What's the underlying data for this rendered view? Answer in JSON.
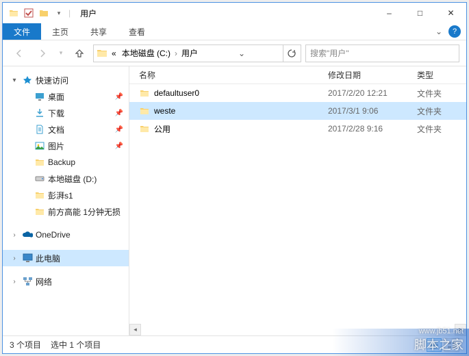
{
  "window": {
    "title": "用户",
    "minimize": "–",
    "maximize": "□",
    "close": "✕"
  },
  "ribbon": {
    "file": "文件",
    "tabs": [
      "主页",
      "共享",
      "查看"
    ]
  },
  "address": {
    "crumb1": "本地磁盘 (C:)",
    "crumb2": "用户",
    "prefix": "«"
  },
  "search": {
    "placeholder": "搜索\"用户\""
  },
  "sidebar": {
    "quick_access": "快速访问",
    "items": [
      {
        "label": "桌面",
        "pinned": true
      },
      {
        "label": "下载",
        "pinned": true
      },
      {
        "label": "文档",
        "pinned": true
      },
      {
        "label": "图片",
        "pinned": true
      },
      {
        "label": "Backup",
        "pinned": false
      },
      {
        "label": "本地磁盘 (D:)",
        "pinned": false
      },
      {
        "label": "彭湃s1",
        "pinned": false
      },
      {
        "label": "前方高能 1分钟无损",
        "pinned": false
      }
    ],
    "onedrive": "OneDrive",
    "this_pc": "此电脑",
    "network": "网络"
  },
  "file_list": {
    "headers": {
      "name": "名称",
      "date": "修改日期",
      "type": "类型"
    },
    "rows": [
      {
        "name": "defaultuser0",
        "date": "2017/2/20 12:21",
        "type": "文件夹",
        "selected": false
      },
      {
        "name": "weste",
        "date": "2017/3/1 9:06",
        "type": "文件夹",
        "selected": true
      },
      {
        "name": "公用",
        "date": "2017/2/28 9:16",
        "type": "文件夹",
        "selected": false
      }
    ]
  },
  "statusbar": {
    "count": "3 个项目",
    "selection": "选中 1 个项目"
  },
  "watermark": {
    "site": "脚本之家",
    "url": "www.jb51.net"
  }
}
